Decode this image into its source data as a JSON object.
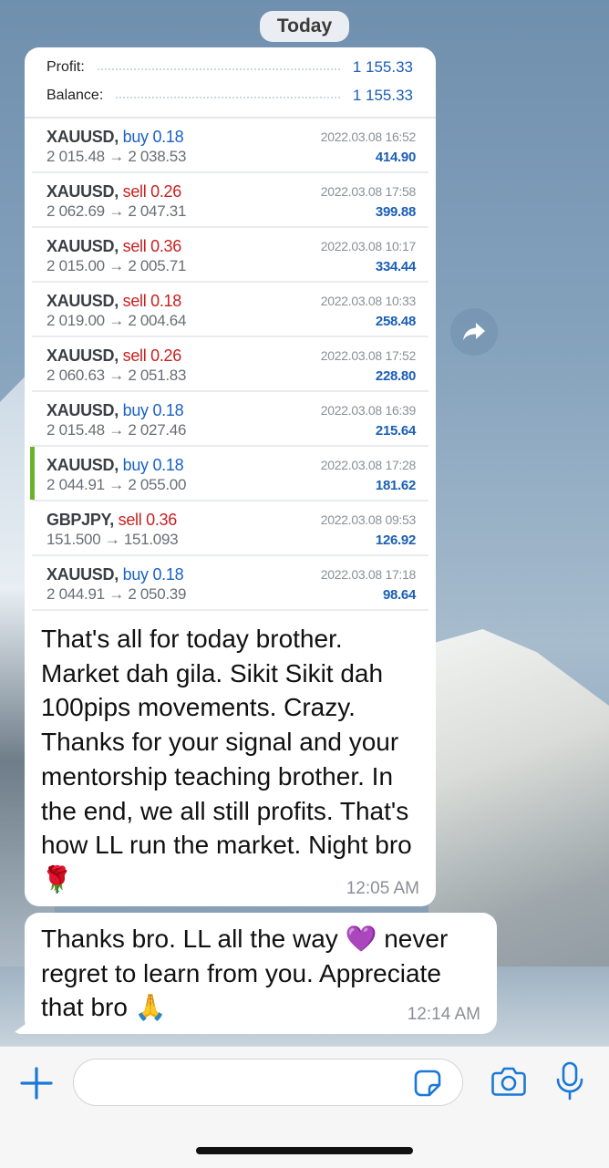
{
  "date_label": "Today",
  "summary": [
    {
      "label": "Profit:",
      "value": "1 155.33"
    },
    {
      "label": "Balance:",
      "value": "1 155.33"
    }
  ],
  "trades": [
    {
      "symbol": "XAUUSD,",
      "direction": "buy 0.18",
      "type": "buy",
      "prices": "2 015.48 → 2 038.53",
      "time": "2022.03.08 16:52",
      "profit": "414.90"
    },
    {
      "symbol": "XAUUSD,",
      "direction": "sell 0.26",
      "type": "sell",
      "prices": "2 062.69 → 2 047.31",
      "time": "2022.03.08 17:58",
      "profit": "399.88"
    },
    {
      "symbol": "XAUUSD,",
      "direction": "sell 0.36",
      "type": "sell",
      "prices": "2 015.00 → 2 005.71",
      "time": "2022.03.08 10:17",
      "profit": "334.44"
    },
    {
      "symbol": "XAUUSD,",
      "direction": "sell 0.18",
      "type": "sell",
      "prices": "2 019.00 → 2 004.64",
      "time": "2022.03.08 10:33",
      "profit": "258.48"
    },
    {
      "symbol": "XAUUSD,",
      "direction": "sell 0.26",
      "type": "sell",
      "prices": "2 060.63 → 2 051.83",
      "time": "2022.03.08 17:52",
      "profit": "228.80"
    },
    {
      "symbol": "XAUUSD,",
      "direction": "buy 0.18",
      "type": "buy",
      "prices": "2 015.48 → 2 027.46",
      "time": "2022.03.08 16:39",
      "profit": "215.64"
    },
    {
      "symbol": "XAUUSD,",
      "direction": "buy 0.18",
      "type": "buy",
      "prices": "2 044.91 → 2 055.00",
      "time": "2022.03.08 17:28",
      "profit": "181.62"
    },
    {
      "symbol": "GBPJPY,",
      "direction": "sell 0.36",
      "type": "sell",
      "prices": "151.500 → 151.093",
      "time": "2022.03.08 09:53",
      "profit": "126.92"
    },
    {
      "symbol": "XAUUSD,",
      "direction": "buy 0.18",
      "type": "buy",
      "prices": "2 044.91 → 2 050.39",
      "time": "2022.03.08 17:18",
      "profit": "98.64"
    }
  ],
  "incoming_message": {
    "text": "That's all for today brother. Market dah gila. Sikit Sikit dah 100pips movements. Crazy. Thanks for your signal and your mentorship teaching brother. In the end, we all still profits. That's how LL run the market. Night bro 🌹",
    "time": "12:05 AM"
  },
  "reply_message": {
    "text": "Thanks bro. LL all the way 💜 never regret to learn from you. Appreciate that bro 🙏",
    "time": "12:14 AM"
  },
  "colors": {
    "profit_blue": "#1a5fb4",
    "buy_blue": "#1a62c6",
    "sell_red": "#c82020",
    "active_marker": "#6bb22b",
    "ios_blue": "#1a78d6"
  }
}
